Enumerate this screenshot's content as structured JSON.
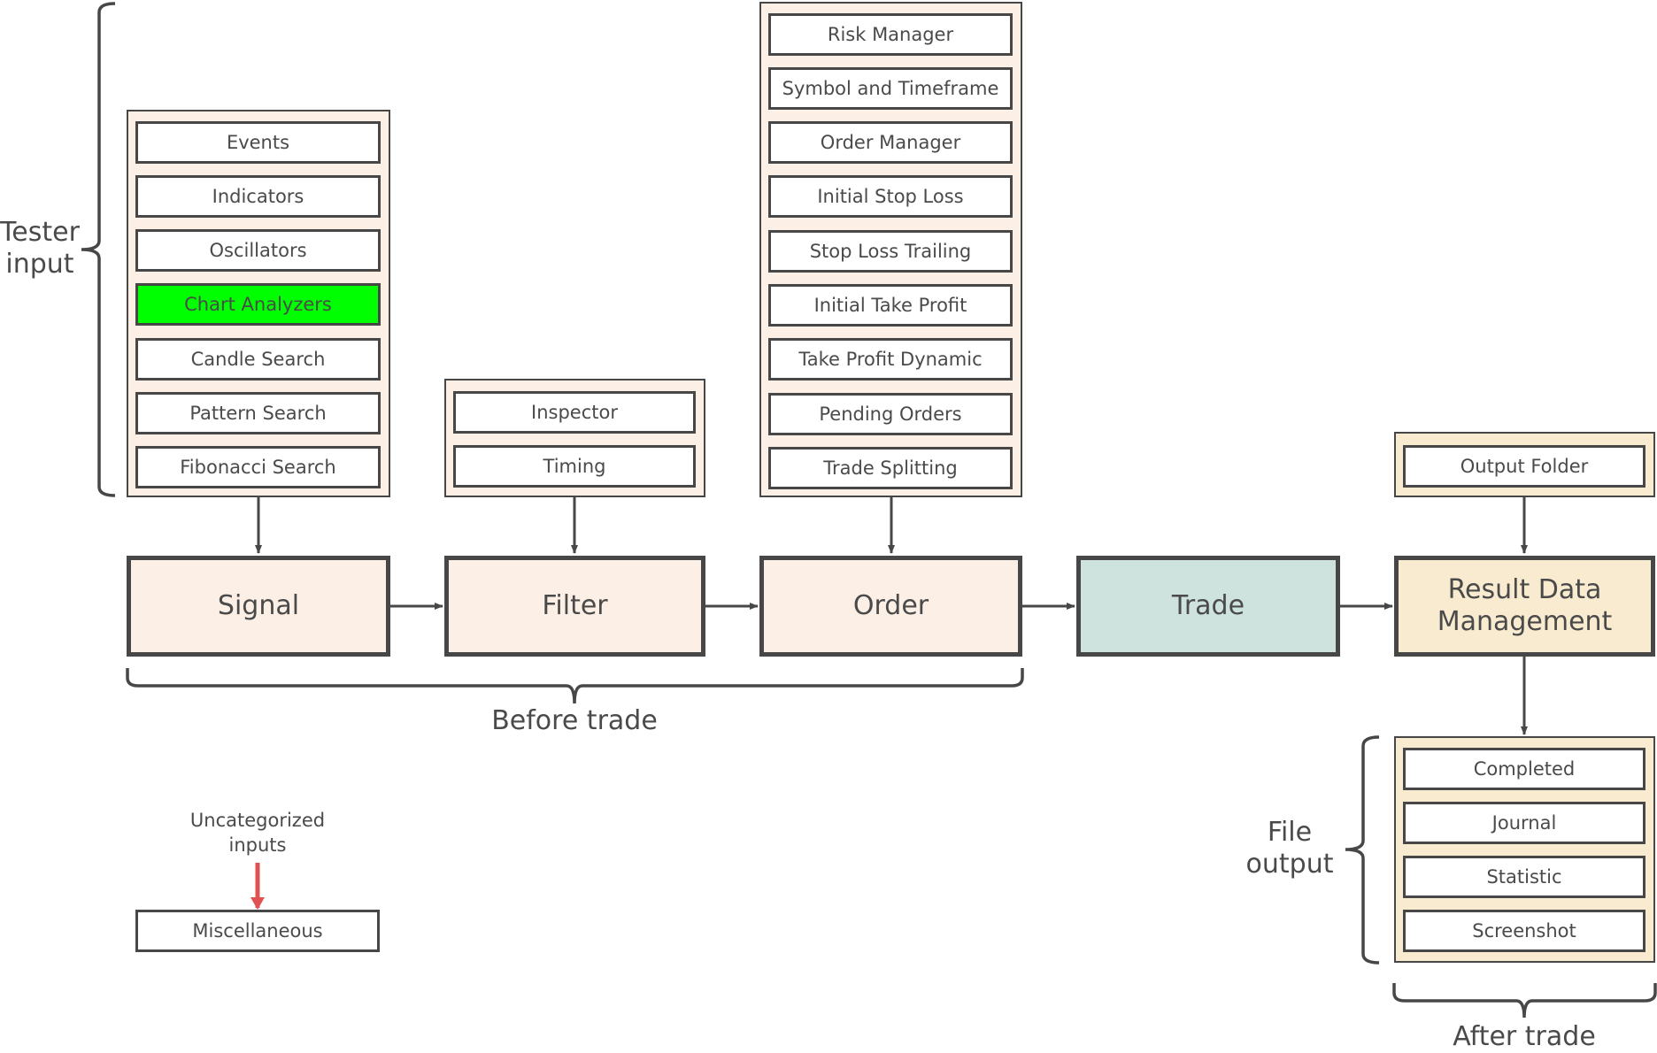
{
  "groups": {
    "signal_inputs": [
      "Events",
      "Indicators",
      "Oscillators",
      "Chart Analyzers",
      "Candle Search",
      "Pattern Search",
      "Fibonacci Search"
    ],
    "signal_highlighted_item": "Chart Analyzers",
    "filter_inputs": [
      "Inspector",
      "Timing"
    ],
    "order_inputs": [
      "Risk Manager",
      "Symbol and Timeframe",
      "Order Manager",
      "Initial Stop Loss",
      "Stop Loss Trailing",
      "Initial Take Profit",
      "Take Profit Dynamic",
      "Pending Orders",
      "Trade Splitting"
    ],
    "result_inputs": [
      "Output Folder"
    ],
    "file_outputs": [
      "Completed",
      "Journal",
      "Statistic",
      "Screenshot"
    ]
  },
  "stages": {
    "signal": "Signal",
    "filter": "Filter",
    "order": "Order",
    "trade": "Trade",
    "result": "Result Data Management"
  },
  "annotations": {
    "tester_input": "Tester input",
    "before_trade": "Before trade",
    "after_trade": "After trade",
    "file_output": "File output",
    "uncategorized_inputs": "Uncategorized inputs"
  },
  "misc": {
    "label": "Miscellaneous"
  },
  "colors": {
    "input_group_bg": "#fcefe5",
    "output_group_bg": "#f8ebcf",
    "trade_bg": "#cee3de",
    "highlight": "#00ff00",
    "uncategorized_arrow": "#e05252",
    "stroke": "#474747"
  }
}
